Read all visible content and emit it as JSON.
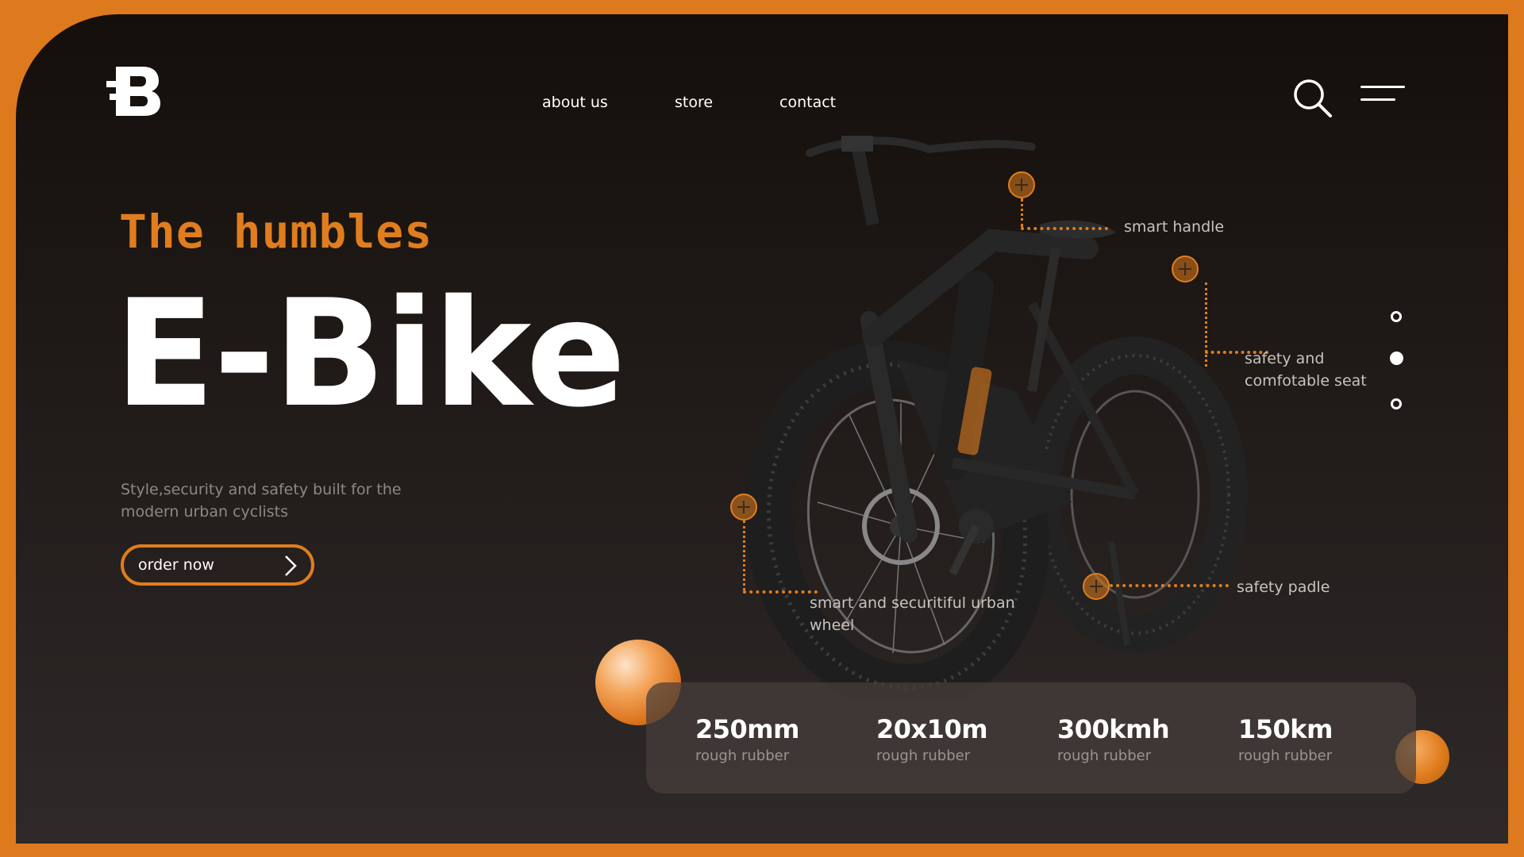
{
  "brand": {
    "logo_icon": "b-logo-icon"
  },
  "nav": {
    "items": [
      "about us",
      "store",
      "contact"
    ]
  },
  "header_icons": {
    "search": "search-icon",
    "menu": "hamburger-menu-icon"
  },
  "hero": {
    "tagline": "The humbles",
    "title": "E-Bike",
    "subtitle": "Style,security and safety built for the modern urban cyclists",
    "cta_label": "order now"
  },
  "features": [
    {
      "label": "smart handle"
    },
    {
      "label": "safety and comfotable seat"
    },
    {
      "label": "smart and securitiful urban wheel"
    },
    {
      "label": "safety padle"
    }
  ],
  "slider": {
    "total": 3,
    "active_index": 2
  },
  "stats": [
    {
      "value": "250mm",
      "caption": "rough rubber"
    },
    {
      "value": "20x10m",
      "caption": "rough rubber"
    },
    {
      "value": "300kmh",
      "caption": "rough rubber"
    },
    {
      "value": "150km",
      "caption": "rough rubber"
    }
  ],
  "colors": {
    "accent": "#e07d1e",
    "background": "#1b1512",
    "frame": "#dd7a1e",
    "text": "#ffffff"
  }
}
